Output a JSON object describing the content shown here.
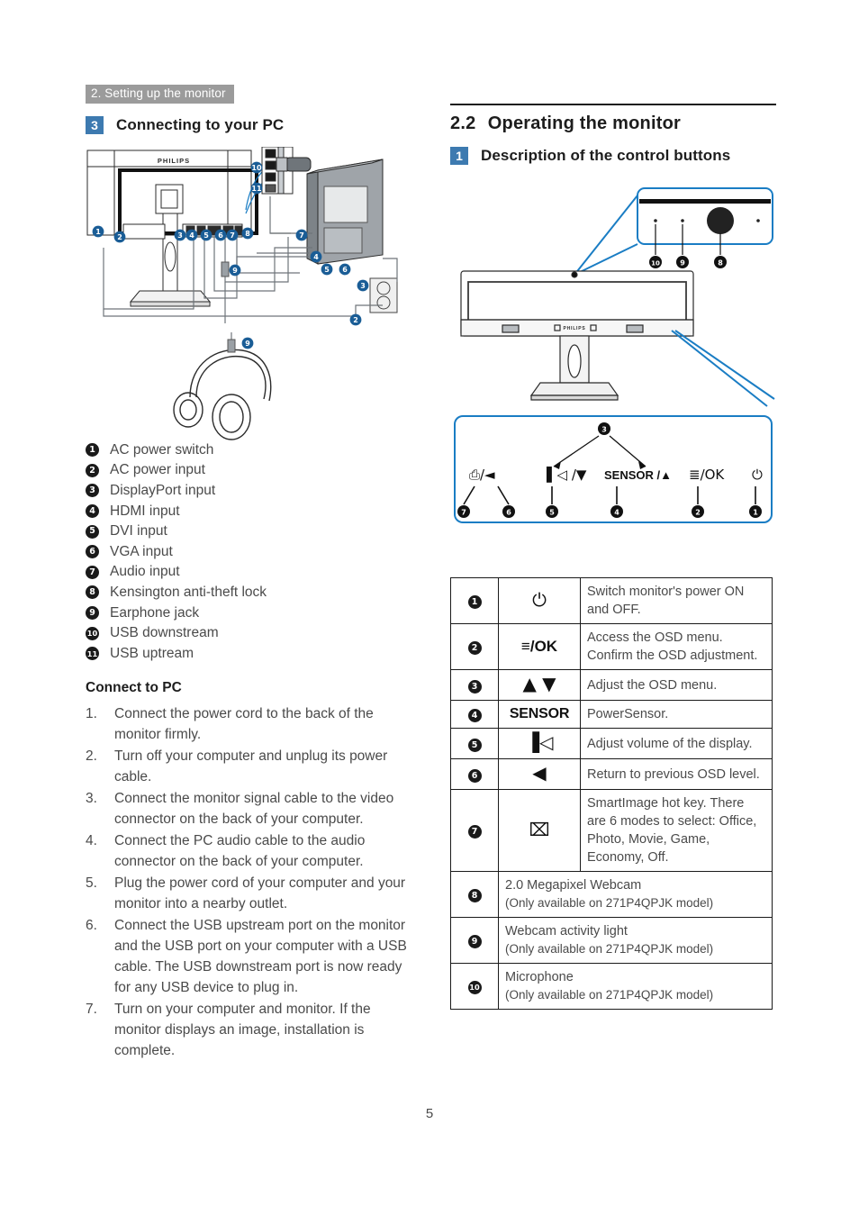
{
  "document": {
    "running_header": "2. Setting up the monitor",
    "page_number": "5"
  },
  "left": {
    "subsection": {
      "badge": "3",
      "title": "Connecting to your PC"
    },
    "diagram_name": "monitor-rear-connections-diagram",
    "brand": "PHILIPS",
    "ports": [
      {
        "num": "1",
        "label": "AC power switch"
      },
      {
        "num": "2",
        "label": "AC power input"
      },
      {
        "num": "3",
        "label": "DisplayPort input"
      },
      {
        "num": "4",
        "label": "HDMI input"
      },
      {
        "num": "5",
        "label": "DVI input"
      },
      {
        "num": "6",
        "label": "VGA input"
      },
      {
        "num": "7",
        "label": "Audio input"
      },
      {
        "num": "8",
        "label": "Kensington anti-theft lock"
      },
      {
        "num": "9",
        "label": "Earphone jack"
      },
      {
        "num": "10",
        "label": "USB downstream"
      },
      {
        "num": "11",
        "label": "USB uptream"
      }
    ],
    "connect_heading": "Connect to PC",
    "steps": [
      {
        "n": "1.",
        "text": "Connect the power cord to the back of the monitor firmly."
      },
      {
        "n": "2.",
        "text": "Turn off your computer and unplug its power cable."
      },
      {
        "n": "3.",
        "text": "Connect the monitor signal cable to the video connector on the back of your computer."
      },
      {
        "n": "4.",
        "text": "Connect the PC audio cable to the audio connector on the back of your computer."
      },
      {
        "n": "5.",
        "text": "Plug the power cord of your computer and your monitor into a nearby outlet."
      },
      {
        "n": "6.",
        "text": "Connect the USB upstream port on the monitor and the USB port on your computer with a USB cable. The USB downstream port is now ready for any USB device to plug in."
      },
      {
        "n": "7.",
        "text": "Turn on your computer and monitor. If the monitor displays an image, installation is complete."
      }
    ]
  },
  "right": {
    "section": {
      "number": "2.2",
      "title": "Operating the monitor"
    },
    "subsection": {
      "badge": "1",
      "title": "Description of the control buttons"
    },
    "webcam_callouts": [
      {
        "num": "10",
        "name": "microphone-callout"
      },
      {
        "num": "9",
        "name": "webcam-light-callout"
      },
      {
        "num": "8",
        "name": "webcam-callout"
      }
    ],
    "control_panel": {
      "top_callout": "3",
      "buttons": [
        {
          "label": "⌧/◀",
          "icon": "smartimage-back-icon",
          "callouts": [
            "7",
            "6"
          ]
        },
        {
          "label": "▐◁ /▼",
          "icon": "volume-down-icon",
          "callouts": [
            "5"
          ]
        },
        {
          "label": "SENSOR /▲",
          "icon": "sensor-up-icon",
          "callouts": [
            "4"
          ]
        },
        {
          "label": "≡/OK",
          "icon": "osd-ok-icon",
          "callouts": [
            "2"
          ]
        },
        {
          "label": "⏻",
          "icon": "power-icon",
          "callouts": [
            "1"
          ]
        }
      ]
    },
    "table": {
      "name": "control-buttons-table",
      "rows": [
        {
          "num": "1",
          "icon": "power-icon",
          "icon_text": "⏻",
          "desc": "Switch monitor's power ON and OFF."
        },
        {
          "num": "2",
          "icon": "osd-ok-icon",
          "icon_text": "≡/OK",
          "desc": "Access the OSD menu.\nConfirm the OSD adjustment."
        },
        {
          "num": "3",
          "icon": "up-down-arrows-icon",
          "icon_text": "▲ ▼",
          "desc": "Adjust the OSD menu."
        },
        {
          "num": "4",
          "icon": "sensor-icon",
          "icon_text": "SENSOR",
          "desc": "PowerSensor."
        },
        {
          "num": "5",
          "icon": "volume-icon",
          "icon_text": "▐◁",
          "desc": "Adjust volume of the display."
        },
        {
          "num": "6",
          "icon": "left-arrow-icon",
          "icon_text": "◀",
          "desc": "Return to previous OSD level."
        },
        {
          "num": "7",
          "icon": "smartimage-icon",
          "icon_text": "⌧",
          "desc": "SmartImage hot key. There are 6 modes to select: Office, Photo, Movie, Game, Economy, Off."
        }
      ],
      "wide_rows": [
        {
          "num": "8",
          "title": "2.0 Megapixel Webcam",
          "note": "(Only available on 271P4QPJK model)"
        },
        {
          "num": "9",
          "title": "Webcam activity light",
          "note": "(Only available on 271P4QPJK model)"
        },
        {
          "num": "10",
          "title": "Microphone",
          "note": "(Only available on 271P4QPJK model)"
        }
      ]
    }
  },
  "colors": {
    "banner_gray": "#9b9b9b",
    "badge_blue": "#3d7ab0",
    "diagram_blue": "#1a7dc4",
    "text": "#4a4a4a",
    "heading": "#1d1d1d"
  }
}
